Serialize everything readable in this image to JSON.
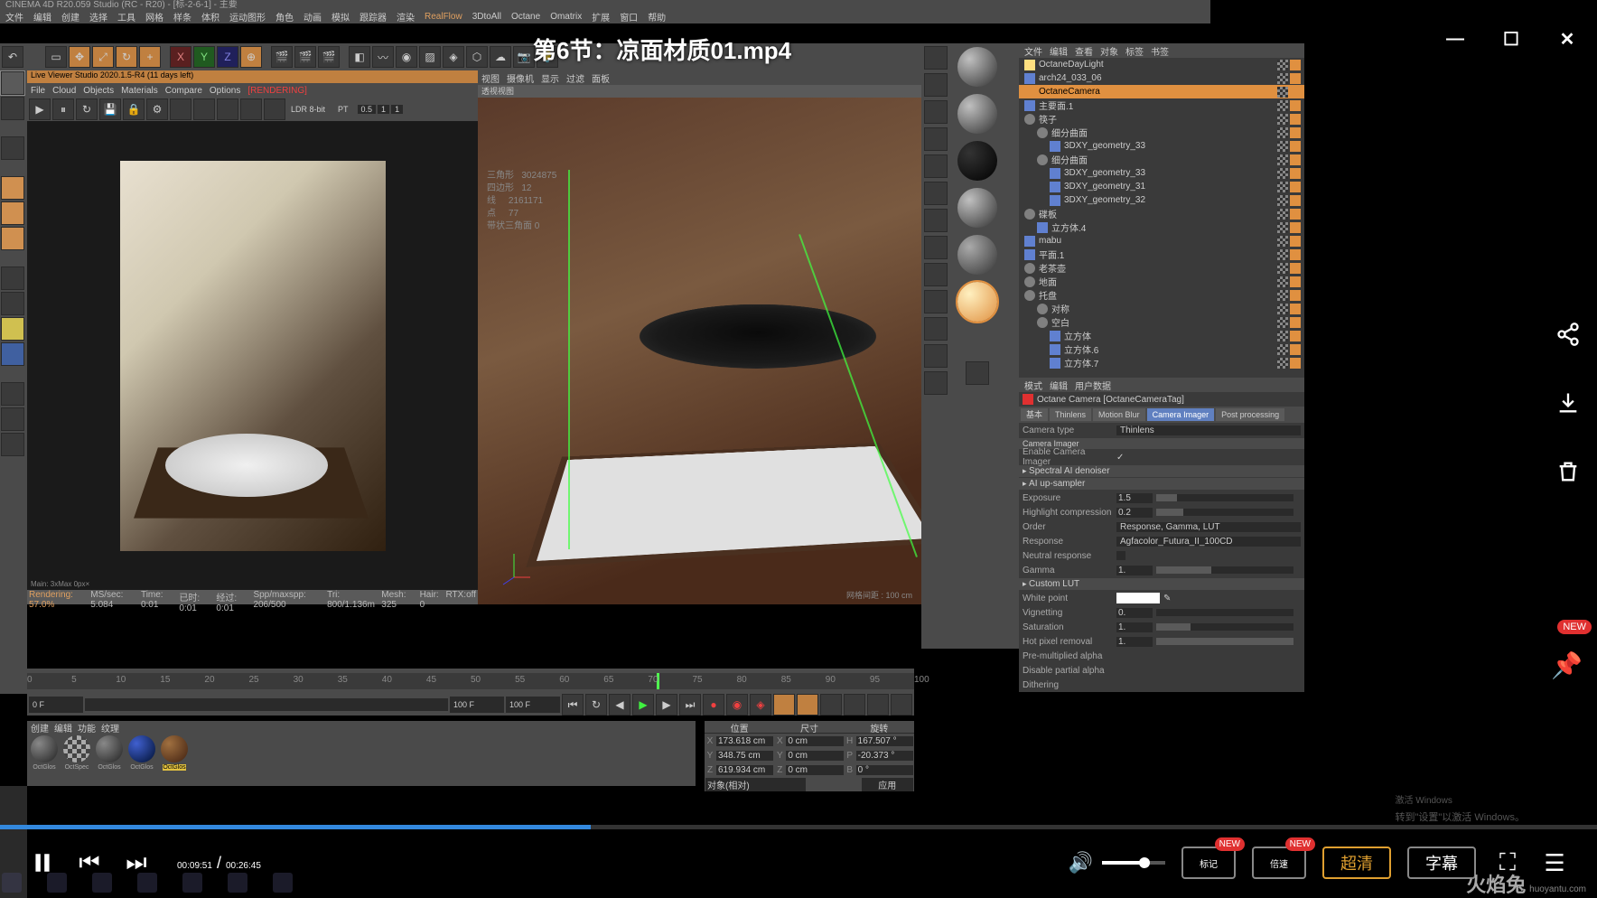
{
  "app_title": "CINEMA 4D R20.059 Studio (RC - R20) - [标-2-6-1] - 主要",
  "main_menu": [
    "文件",
    "编辑",
    "创建",
    "选择",
    "工具",
    "网格",
    "样条",
    "体积",
    "运动图形",
    "角色",
    "动画",
    "模拟",
    "跟踪器",
    "渲染",
    "RealFlow",
    "3DtoAll",
    "Octane",
    "Omatrix",
    "扩展",
    "窗口",
    "帮助"
  ],
  "video_title": "第6节：凉面材质01.mp4",
  "video_controls": {
    "current": "00:09:51",
    "total": "00:26:45",
    "mark": "标记",
    "speed": "倍速",
    "quality": "超清",
    "subtitle": "字幕",
    "new": "NEW"
  },
  "live_viewer": {
    "title": "Live Viewer Studio 2020.1.5-R4 (11 days left)",
    "menu": [
      "File",
      "Cloud",
      "Objects",
      "Materials",
      "Compare",
      "Options"
    ],
    "rendering": "[RENDERING]",
    "mode": "LDR 8-bit",
    "pt": "PT",
    "v1": "0.5",
    "v2": "1",
    "v3": "1",
    "coords": "Main: 3xMax 0px×",
    "status": [
      "Rendering: 57.0%",
      "MS/sec: 5.084",
      "Time: 0:01",
      "已时: 0:01",
      "经过: 0:01",
      "Spp/maxspp: 206/500",
      "Tri: 800/1.136m",
      "Mesh: 325",
      "Hair: 0",
      "RTX:off"
    ]
  },
  "viewport": {
    "menu": [
      "视图",
      "摄像机",
      "显示",
      "过滤",
      "面板"
    ],
    "label": "透视视图",
    "hud": {
      "l1": "三角形",
      "v1": "3024875",
      "l2": "四边形",
      "v2": "12",
      "l3": "线",
      "v3": "2161171",
      "l4": "点",
      "v4": "77",
      "l5": "带状三角面 0"
    },
    "grid": "网格间距 : 100 cm"
  },
  "objects": {
    "tabs": [
      "文件",
      "编辑",
      "查看",
      "对象",
      "标签",
      "书签"
    ],
    "rows": [
      {
        "n": "OctaneDayLight",
        "t": "light",
        "d": 0
      },
      {
        "n": "arch24_033_06",
        "t": "poly",
        "d": 0
      },
      {
        "n": "OctaneCamera",
        "t": "cam",
        "d": 0,
        "active": true
      },
      {
        "n": "主要面.1",
        "t": "poly",
        "d": 0
      },
      {
        "n": "筷子",
        "t": "null",
        "d": 0
      },
      {
        "n": "细分曲面",
        "t": "null",
        "d": 1
      },
      {
        "n": "3DXY_geometry_33",
        "t": "poly",
        "d": 2
      },
      {
        "n": "细分曲面",
        "t": "null",
        "d": 1
      },
      {
        "n": "3DXY_geometry_33",
        "t": "poly",
        "d": 2
      },
      {
        "n": "3DXY_geometry_31",
        "t": "poly",
        "d": 2
      },
      {
        "n": "3DXY_geometry_32",
        "t": "poly",
        "d": 2
      },
      {
        "n": "碟板",
        "t": "null",
        "d": 0
      },
      {
        "n": "立方体.4",
        "t": "poly",
        "d": 1
      },
      {
        "n": "mabu",
        "t": "poly",
        "d": 0
      },
      {
        "n": "平面.1",
        "t": "poly",
        "d": 0
      },
      {
        "n": "老茶壶",
        "t": "null",
        "d": 0
      },
      {
        "n": "地面",
        "t": "null",
        "d": 0
      },
      {
        "n": "托盘",
        "t": "null",
        "d": 0
      },
      {
        "n": "对称",
        "t": "null",
        "d": 1
      },
      {
        "n": "空白",
        "t": "null",
        "d": 1
      },
      {
        "n": "立方体",
        "t": "poly",
        "d": 2
      },
      {
        "n": "立方体.6",
        "t": "poly",
        "d": 2
      },
      {
        "n": "立方体.7",
        "t": "poly",
        "d": 2
      }
    ]
  },
  "attributes": {
    "mode_tabs": [
      "模式",
      "编辑",
      "用户数据"
    ],
    "object": "Octane Camera [OctaneCameraTag]",
    "tabs": [
      "基本",
      "Thinlens",
      "Motion Blur",
      "Camera Imager",
      "Post processing"
    ],
    "camera_type_label": "Camera type",
    "camera_type": "Thinlens",
    "section": "Camera Imager",
    "enable_label": "Enable Camera Imager",
    "sec1": "Spectral AI denoiser",
    "sec2": "AI up-sampler",
    "exposure_l": "Exposure",
    "exposure": "1.5",
    "highlight_l": "Highlight compression",
    "highlight": "0.2",
    "order_l": "Order",
    "order": "Response, Gamma, LUT",
    "response_l": "Response",
    "response": "Agfacolor_Futura_II_100CD",
    "neutral_l": "Neutral response",
    "gamma_l": "Gamma",
    "gamma": "1.",
    "sec3": "Custom LUT",
    "white_l": "White point",
    "vignetting_l": "Vignetting",
    "vignetting": "0.",
    "saturation_l": "Saturation",
    "saturation": "1.",
    "hotpixel_l": "Hot pixel removal",
    "hotpixel": "1.",
    "premult_l": "Pre-multiplied alpha",
    "disable_l": "Disable partial alpha",
    "dither_l": "Dithering"
  },
  "coords": {
    "head": [
      "位置",
      "尺寸",
      "旋转"
    ],
    "x": {
      "p": "173.618 cm",
      "s": "0 cm",
      "r": "167.507 °"
    },
    "y": {
      "p": "348.75 cm",
      "s": "0 cm",
      "r": "-20.373 °"
    },
    "z": {
      "p": "619.934 cm",
      "s": "0 cm",
      "r": "0 °"
    },
    "mode": "对象(相对)",
    "apply": "应用"
  },
  "timeline": {
    "ticks": [
      "0",
      "5",
      "10",
      "15",
      "20",
      "25",
      "30",
      "35",
      "40",
      "45",
      "50",
      "55",
      "60",
      "65",
      "70",
      "75",
      "80",
      "85",
      "90",
      "95",
      "100"
    ],
    "cur": "71",
    "start": "0 F",
    "end": "100 F",
    "end2": "100 F"
  },
  "materials": {
    "tabs": [
      "创建",
      "编辑",
      "功能",
      "纹理"
    ],
    "items": [
      "OctGlos",
      "OctSpec",
      "OctGlos",
      "OctGlos",
      "OctGlos"
    ]
  },
  "activate": {
    "l1": "激活 Windows",
    "l2": "转到\"设置\"以激活 Windows。"
  },
  "watermark": {
    "logo": "火焰兔",
    "url": "huoyantu.com"
  }
}
